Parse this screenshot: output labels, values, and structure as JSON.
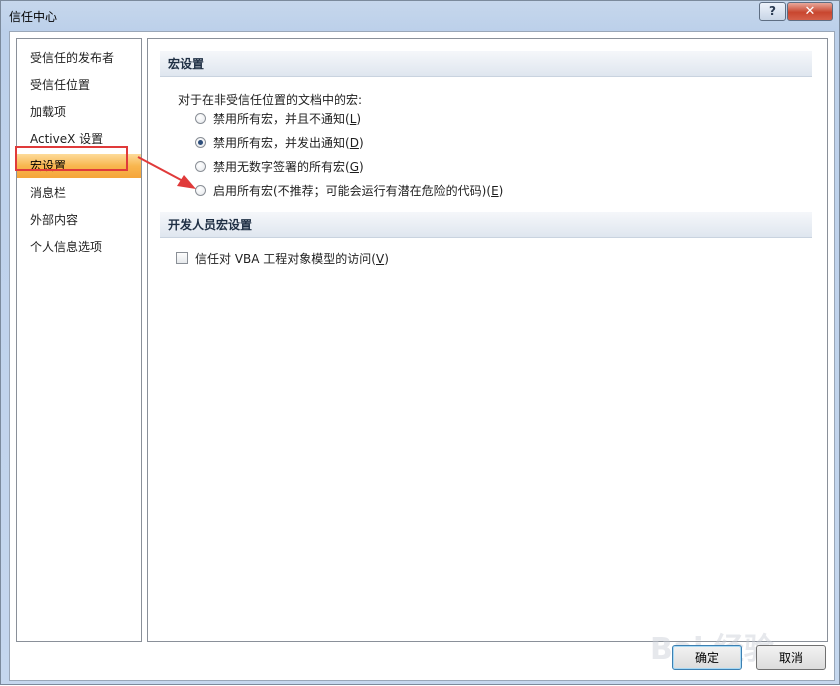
{
  "window": {
    "title": "信任中心",
    "help_label": "?",
    "close_label": "✕"
  },
  "sidebar": {
    "items": [
      {
        "label": "受信任的发布者"
      },
      {
        "label": "受信任位置"
      },
      {
        "label": "加载项"
      },
      {
        "label": "ActiveX 设置"
      },
      {
        "label": "宏设置",
        "selected": true
      },
      {
        "label": "消息栏"
      },
      {
        "label": "外部内容"
      },
      {
        "label": "个人信息选项"
      }
    ]
  },
  "macro_settings": {
    "header": "宏设置",
    "description": "对于在非受信任位置的文档中的宏:",
    "options": [
      {
        "label": "禁用所有宏，并且不通知",
        "accel": "L",
        "checked": false
      },
      {
        "label": "禁用所有宏，并发出通知",
        "accel": "D",
        "checked": true
      },
      {
        "label": "禁用无数字签署的所有宏",
        "accel": "G",
        "checked": false
      },
      {
        "label": "启用所有宏(不推荐；可能会运行有潜在危险的代码)",
        "accel": "E",
        "checked": false
      }
    ]
  },
  "developer_settings": {
    "header": "开发人员宏设置",
    "vba_access": {
      "label": "信任对 VBA 工程对象模型的访问",
      "accel": "V",
      "checked": false
    }
  },
  "buttons": {
    "ok_label": "确定",
    "cancel_label": "取消"
  },
  "watermark": {
    "text": "Bai 经验"
  },
  "colors": {
    "selection_highlight": "#f8b64f",
    "annotation_red": "#e03a3a"
  }
}
